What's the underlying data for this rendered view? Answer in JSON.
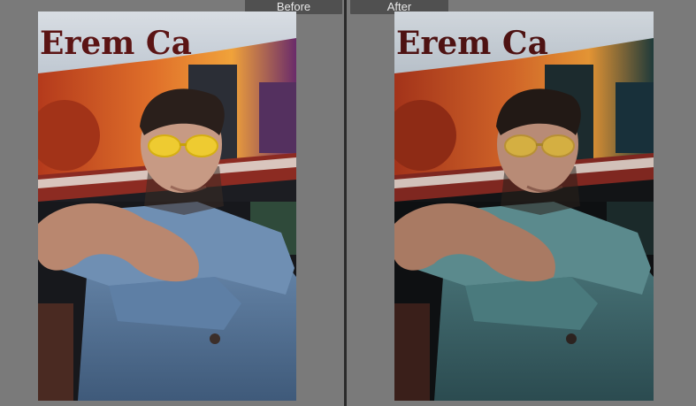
{
  "compare_view": {
    "before_label": "Before",
    "after_label": "After"
  },
  "photo": {
    "sign_text": "Erem Ca",
    "subject": "portrait of young man in yellow glasses and denim jacket"
  },
  "colors": {
    "canvas_gray": "#7a7a7a",
    "tab_bg": "#505050",
    "tab_text": "#e8e8e8",
    "divider": "#2a2a2a"
  }
}
